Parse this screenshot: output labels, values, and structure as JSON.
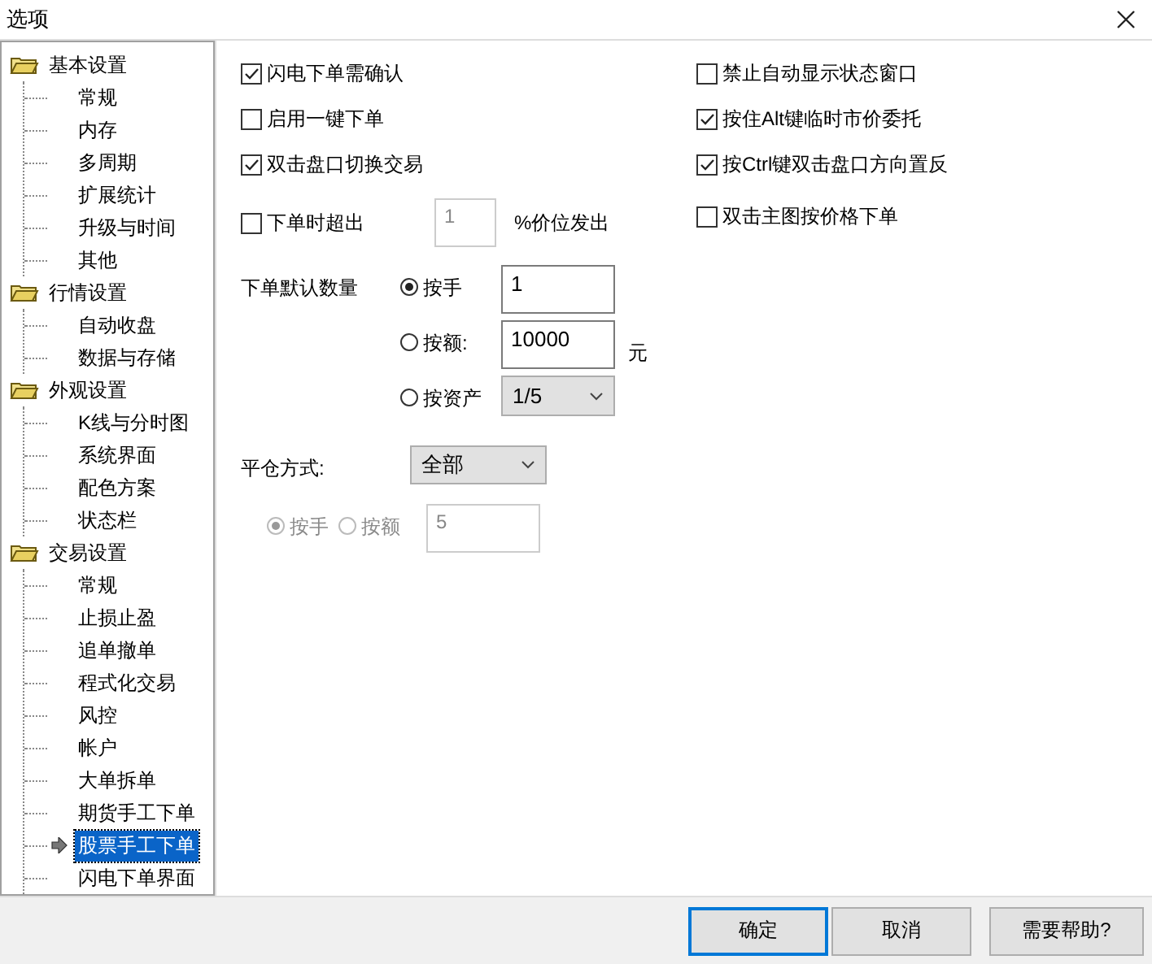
{
  "window": {
    "title": "选项"
  },
  "tree": [
    {
      "label": "基本设置",
      "expanded": true,
      "children": [
        {
          "label": "常规",
          "selected": false
        },
        {
          "label": "内存",
          "selected": false
        },
        {
          "label": "多周期",
          "selected": false
        },
        {
          "label": "扩展统计",
          "selected": false
        },
        {
          "label": "升级与时间",
          "selected": false
        },
        {
          "label": "其他",
          "selected": false
        }
      ]
    },
    {
      "label": "行情设置",
      "expanded": true,
      "children": [
        {
          "label": "自动收盘",
          "selected": false
        },
        {
          "label": "数据与存储",
          "selected": false
        }
      ]
    },
    {
      "label": "外观设置",
      "expanded": true,
      "children": [
        {
          "label": "K线与分时图",
          "selected": false
        },
        {
          "label": "系统界面",
          "selected": false
        },
        {
          "label": "配色方案",
          "selected": false
        },
        {
          "label": "状态栏",
          "selected": false
        }
      ]
    },
    {
      "label": "交易设置",
      "expanded": true,
      "children": [
        {
          "label": "常规",
          "selected": false
        },
        {
          "label": "止损止盈",
          "selected": false
        },
        {
          "label": "追单撤单",
          "selected": false
        },
        {
          "label": "程式化交易",
          "selected": false
        },
        {
          "label": "风控",
          "selected": false
        },
        {
          "label": "帐户",
          "selected": false
        },
        {
          "label": "大单拆单",
          "selected": false
        },
        {
          "label": "期货手工下单",
          "selected": false
        },
        {
          "label": "股票手工下单",
          "selected": true
        },
        {
          "label": "闪电下单界面",
          "selected": false
        }
      ]
    }
  ],
  "left_options": [
    {
      "kind": "checkbox",
      "label": "闪电下单需确认",
      "checked": true
    },
    {
      "kind": "checkbox",
      "label": "启用一键下单",
      "checked": false
    },
    {
      "kind": "checkbox",
      "label": "双击盘口切换交易",
      "checked": true
    },
    {
      "kind": "checkbox_field",
      "label": "下单时超出",
      "checked": false,
      "value": "1",
      "disabled": true,
      "suffix": "%价位发出"
    }
  ],
  "right_options": [
    {
      "label": "禁止自动显示状态窗口",
      "checked": false
    },
    {
      "label": "按住Alt键临时市价委托",
      "checked": true
    },
    {
      "label": "按Ctrl键双击盘口方向置反",
      "checked": true
    },
    {
      "label": "双击主图按价格下单",
      "checked": false
    }
  ],
  "default_quantity": {
    "label": "下单默认数量",
    "options": [
      {
        "kind": "input",
        "label": "按手",
        "selected": true,
        "value": "1"
      },
      {
        "kind": "input",
        "label": "按额:",
        "selected": false,
        "value": "10000",
        "unit": "元"
      },
      {
        "kind": "select",
        "label": "按资产",
        "selected": false,
        "value": "1/5"
      }
    ]
  },
  "close_method": {
    "label": "平仓方式:",
    "value": "全部",
    "disabled": true,
    "radios": [
      {
        "label": "按手",
        "selected": true
      },
      {
        "label": "按额",
        "selected": false
      }
    ],
    "field": "5"
  },
  "buttons": [
    {
      "label": "确定",
      "default": true
    },
    {
      "label": "取消",
      "default": false
    },
    {
      "label": "需要帮助?",
      "default": false
    }
  ]
}
